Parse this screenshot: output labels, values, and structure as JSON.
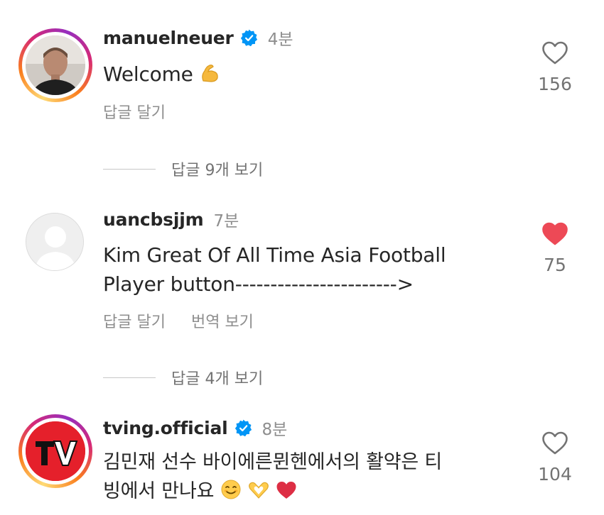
{
  "comments": [
    {
      "username": "manuelneuer",
      "verified": true,
      "time": "4분",
      "text": "Welcome",
      "emoji": [
        "flexed-biceps-emoji"
      ],
      "actions": [
        "답글 달기"
      ],
      "likes": "156",
      "liked": false,
      "view_replies": "답글 9개 보기"
    },
    {
      "username": "uancbsjjm",
      "verified": false,
      "time": "7분",
      "text_line1": "Kim  Great Of All Time Asia Football",
      "text_line2": "Player button----------------------->",
      "actions": [
        "답글 달기",
        "번역 보기"
      ],
      "likes": "75",
      "liked": true,
      "view_replies": "답글 4개 보기"
    },
    {
      "username": "tving.official",
      "verified": true,
      "time": "8분",
      "text_line1": "김민재 선수 바이에른뮌헨에서의 활약은 티",
      "text_line2": "빙에서 만나요",
      "emoji": [
        "smiling-face-emoji",
        "heart-hands-emoji",
        "red-heart-emoji"
      ],
      "likes": "104",
      "liked": false
    }
  ],
  "colors": {
    "text": "#262626",
    "secondary": "#8e8e8e",
    "verified": "#0095f6",
    "liked": "#ed4956",
    "tving_red": "#e5202b"
  }
}
